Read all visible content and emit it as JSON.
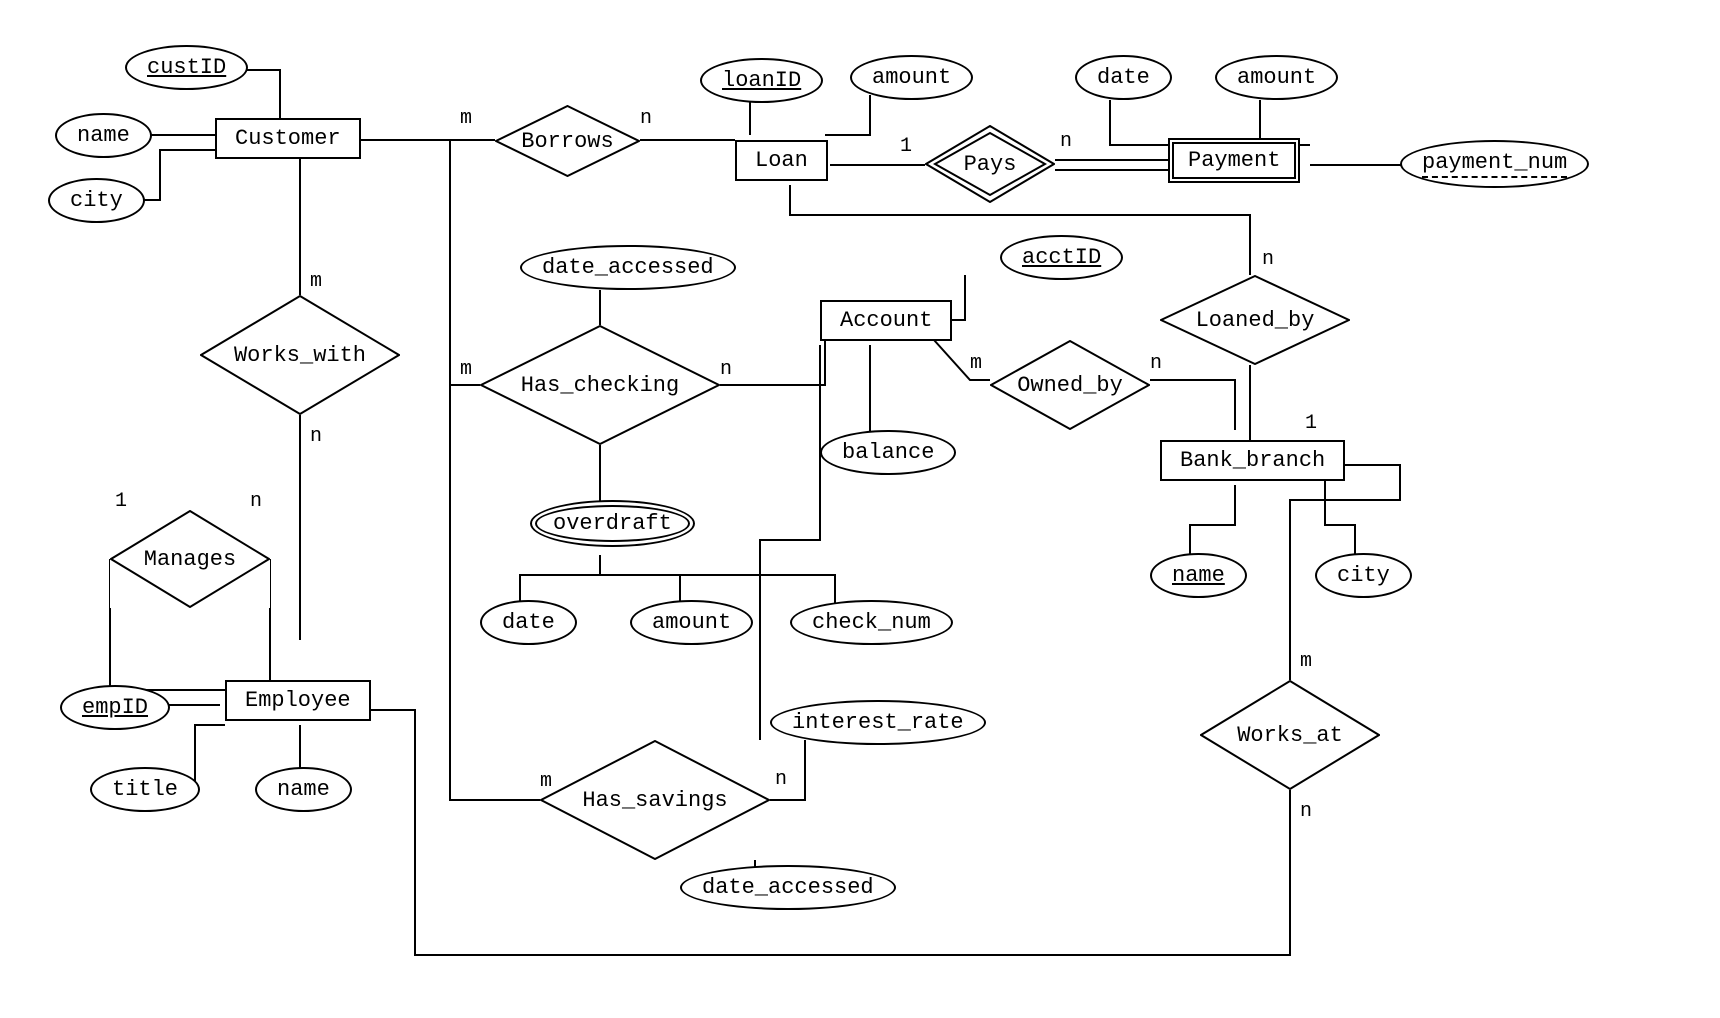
{
  "entities": {
    "customer": "Customer",
    "loan": "Loan",
    "payment": "Payment",
    "account": "Account",
    "bank_branch": "Bank_branch",
    "employee": "Employee"
  },
  "relationships": {
    "borrows": "Borrows",
    "pays": "Pays",
    "works_with": "Works_with",
    "has_checking": "Has_checking",
    "owned_by": "Owned_by",
    "loaned_by": "Loaned_by",
    "manages": "Manages",
    "has_savings": "Has_savings",
    "works_at": "Works_at"
  },
  "attributes": {
    "custID": "custID",
    "cust_name": "name",
    "cust_city": "city",
    "loanID": "loanID",
    "loan_amount": "amount",
    "pay_date": "date",
    "pay_amount": "amount",
    "payment_num": "payment_num",
    "acctID": "acctID",
    "balance": "balance",
    "hc_date_accessed": "date_accessed",
    "overdraft": "overdraft",
    "od_date": "date",
    "od_amount": "amount",
    "od_check_num": "check_num",
    "hs_interest_rate": "interest_rate",
    "hs_date_accessed": "date_accessed",
    "branch_name": "name",
    "branch_city": "city",
    "empID": "empID",
    "emp_title": "title",
    "emp_name": "name"
  },
  "cardinalities": {
    "borrows_left": "m",
    "borrows_right": "n",
    "pays_left": "1",
    "pays_right": "n",
    "works_with_top": "m",
    "works_with_bottom": "n",
    "has_checking_left": "m",
    "has_checking_right": "n",
    "owned_by_left": "m",
    "owned_by_right": "n",
    "loaned_by_top": "n",
    "loaned_by_bottom": "1",
    "manages_left": "1",
    "manages_right": "n",
    "has_savings_left": "m",
    "has_savings_right": "n",
    "works_at_top": "m",
    "works_at_bottom": "n"
  }
}
